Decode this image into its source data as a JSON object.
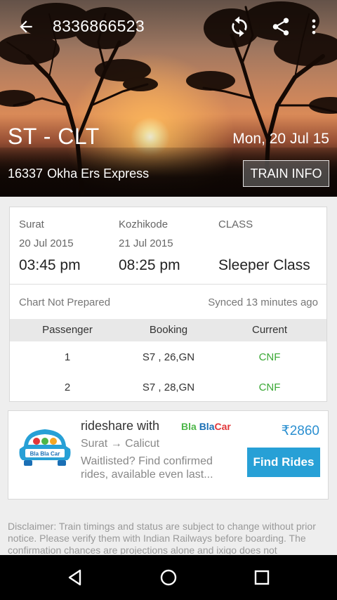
{
  "header": {
    "phone_number": "8336866523",
    "route": "ST - CLT",
    "journey_date": "Mon, 20 Jul 15",
    "train_number": "16337",
    "train_name": "Okha Ers Express",
    "train_info_label": "TRAIN INFO",
    "icons": [
      "arrow-back-icon",
      "refresh-icon",
      "share-icon",
      "more-vert-icon"
    ]
  },
  "journey": {
    "from": {
      "station": "Surat",
      "date": "20 Jul 2015",
      "time": "03:45 pm"
    },
    "to": {
      "station": "Kozhikode",
      "date": "21 Jul 2015",
      "time": "08:25 pm"
    },
    "class": {
      "label": "CLASS",
      "value": "Sleeper Class"
    },
    "chart_status": "Chart Not Prepared",
    "synced": "Synced 13 minutes ago"
  },
  "table": {
    "headers": [
      "Passenger",
      "Booking",
      "Current"
    ],
    "rows": [
      {
        "passenger": "1",
        "booking": "S7 , 26,GN",
        "current": "CNF"
      },
      {
        "passenger": "2",
        "booking": "S7 , 28,GN",
        "current": "CNF"
      }
    ]
  },
  "ad": {
    "title": "rideshare with",
    "brand_parts": [
      "Bla",
      "Bla",
      "Car"
    ],
    "logo_text": "Bla Bla Car",
    "price": "₹2860",
    "route": "Surat → Calicut",
    "description": "Waitlisted? Find confirmed rides, available even last...",
    "button_label": "Find Rides",
    "colors": {
      "button": "#27a0d6",
      "price": "#2b8fd0",
      "bla1": "#4cb648",
      "bla2": "#1a6fb5",
      "car": "#e2373a"
    }
  },
  "disclaimer": "Disclaimer: Train timings and status are subject to change without prior notice. Please verify them with Indian Railways before boarding. The confirmation chances are projections alone and ixigo does not",
  "colors": {
    "confirmed": "#3aa835"
  }
}
